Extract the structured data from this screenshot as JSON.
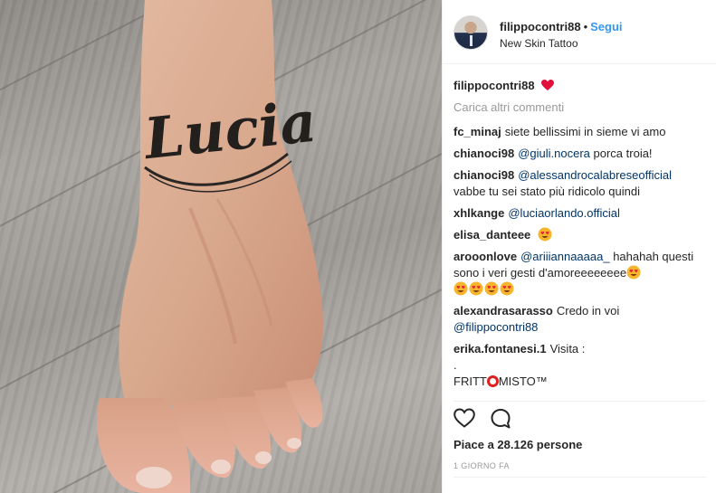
{
  "post": {
    "username": "filippocontri88",
    "dot": "•",
    "follow_label": "Segui",
    "location": "New Skin Tattoo",
    "tattoo_text": "Lucia",
    "caption_user": "filippocontri88",
    "load_more": "Carica altri commenti",
    "likes": "Piace a 28.126 persone",
    "time": "1 giorno fa"
  },
  "comments": [
    {
      "user": "fc_minaj",
      "text": "siete bellissimi in sieme vi amo"
    },
    {
      "user": "chianoci98",
      "mention": "@giuli.nocera",
      "text": "porca troia!"
    },
    {
      "user": "chianoci98",
      "mention": "@alessandrocalabreseofficial",
      "text": "vabbe tu sei stato più ridicolo quindi"
    },
    {
      "user": "xhlkange",
      "mention": "@luciaorlando.official"
    },
    {
      "user": "elisa_danteee"
    },
    {
      "user": "arooonlove",
      "mention": "@ariiiannaaaaa_",
      "text": "hahahah questi sono i veri gesti d'amoreeeeeeee"
    },
    {
      "user": "alexandrasarasso",
      "text": "Credo in voi",
      "mention": "@filippocontri88"
    },
    {
      "user": "erika.fontanesi.1",
      "text": "Visita :",
      "line2": ".",
      "line3a": "FRITT",
      "line3b": "MISTO™"
    }
  ],
  "icons": {
    "like": "heart-outline-icon",
    "comment": "speech-bubble-icon",
    "emoji": "heart-eyes-emoji",
    "caption_emoji": "red-heart-emoji"
  },
  "colors": {
    "link": "#3897f0",
    "mention": "#003569",
    "muted": "#999999"
  }
}
